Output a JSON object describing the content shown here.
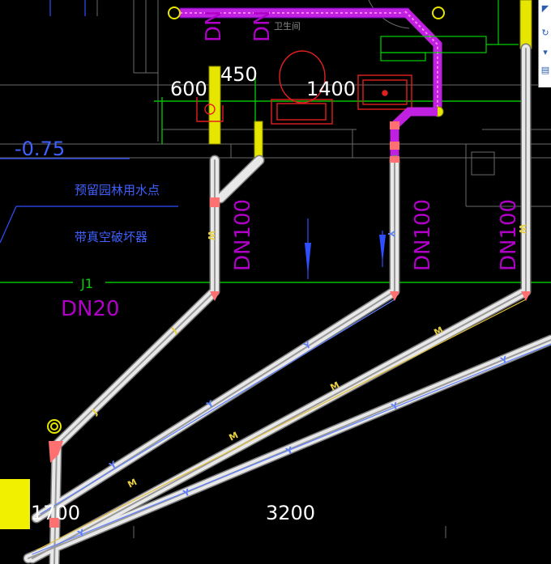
{
  "drawing": {
    "room_label": "卫生间",
    "dims": {
      "d600": "600",
      "d450": "450",
      "d1400": "1400",
      "d1700": "1700",
      "d3200": "3200"
    },
    "level_mark": "-0.75",
    "note1": "预留园林用水点",
    "note2": "带真空破坏器",
    "j1_label": "J1",
    "dn20_label": "DN20",
    "dn100_label": "DN100",
    "dn_top_label": "DN",
    "pipe_codes": {
      "waste": "W",
      "drain": "Y",
      "supply": "J",
      "sewage": "M"
    }
  },
  "colors": {
    "pipe": "#e8e8e8",
    "pipe_edge": "#7a7a7a",
    "fitting": "#ff7070",
    "vent": "#e6e600",
    "dn_magenta": "#b000c8",
    "grid_green": "#00c000",
    "blue_text": "#4060ff"
  },
  "toolbar": {
    "items": [
      "nav-arrow",
      "orbit",
      "dropdown",
      "properties"
    ]
  }
}
